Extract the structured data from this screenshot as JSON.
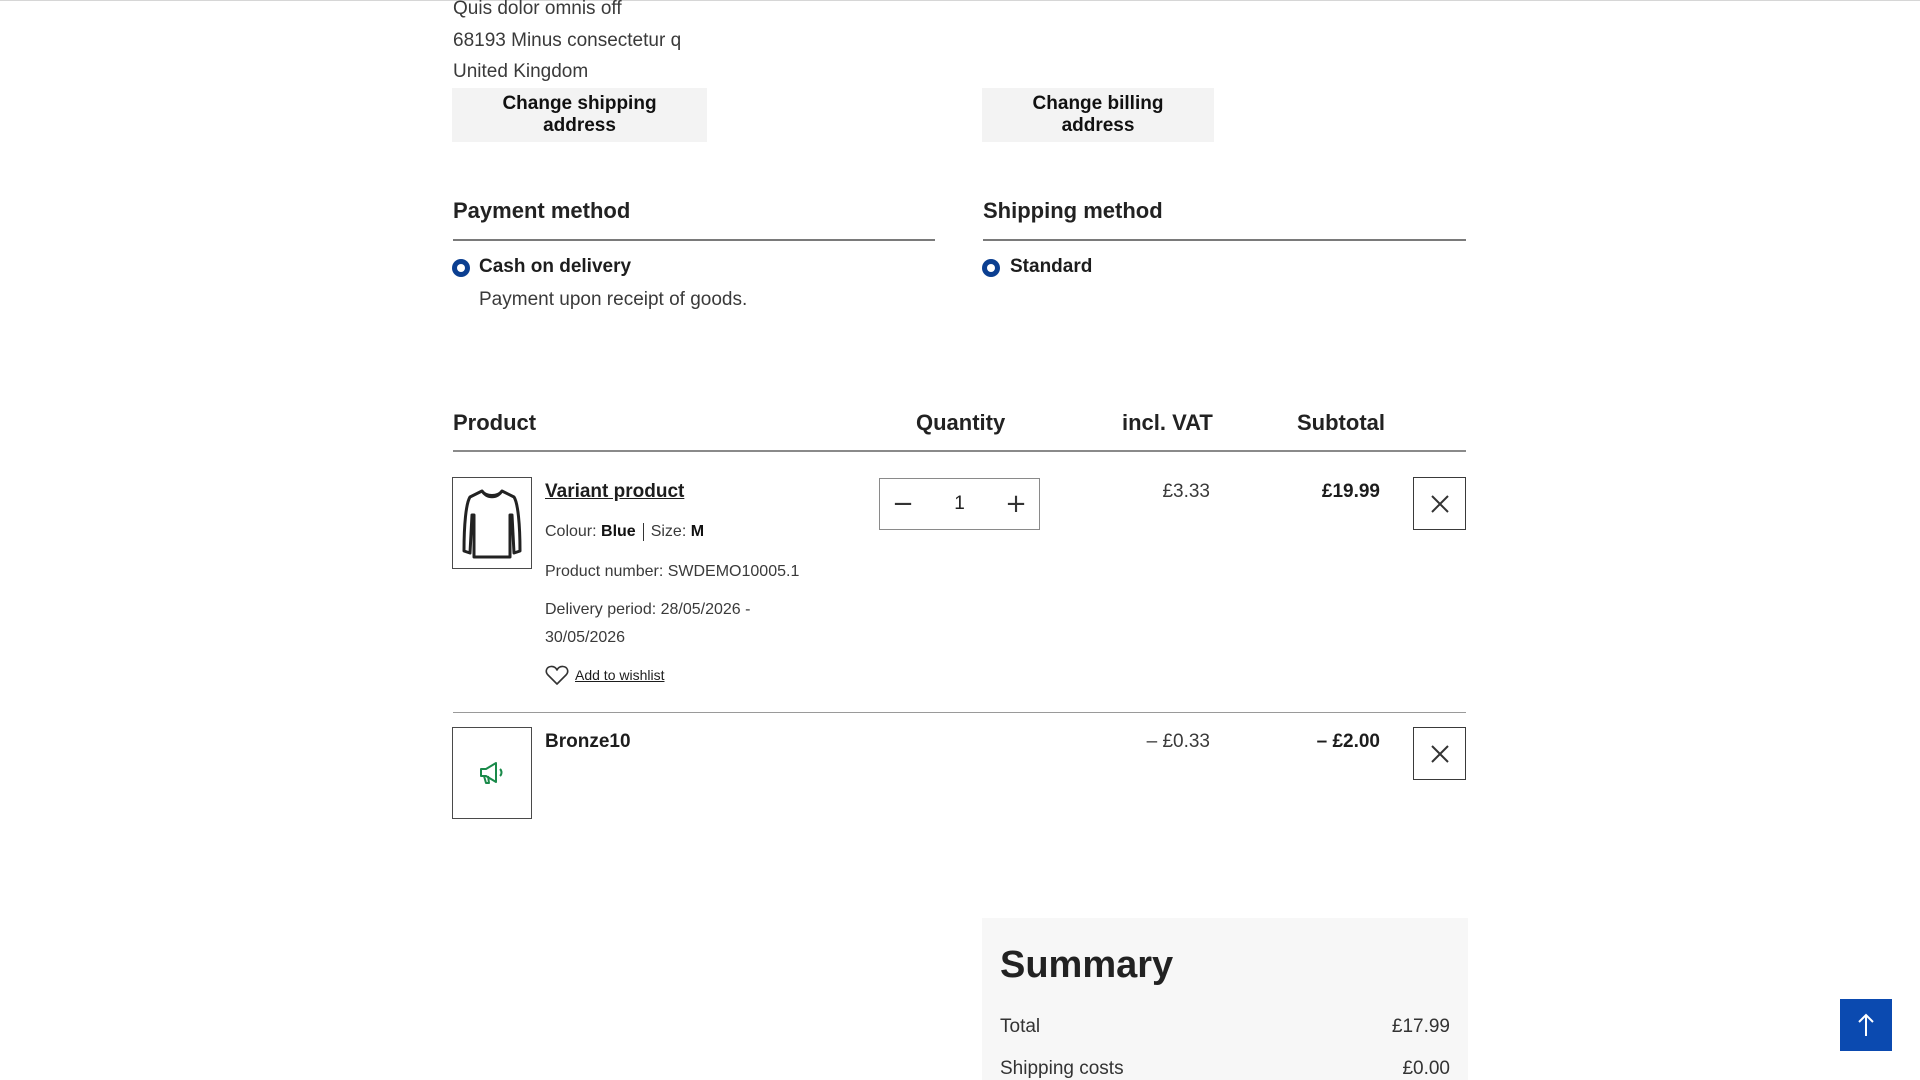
{
  "address": {
    "lines": [
      "Quis dolor omnis off",
      "68193 Minus consectetur q",
      "United Kingdom"
    ],
    "change_shipping_label": "Change shipping address",
    "change_billing_label": "Change billing address"
  },
  "payment": {
    "title": "Payment method",
    "option_label": "Cash on delivery",
    "option_desc": "Payment upon receipt of goods."
  },
  "shipping": {
    "title": "Shipping method",
    "option_label": "Standard"
  },
  "table": {
    "headers": {
      "product": "Product",
      "quantity": "Quantity",
      "vat": "incl. VAT",
      "subtotal": "Subtotal"
    },
    "items": [
      {
        "name": "Variant product",
        "colour_label": "Colour:",
        "colour_value": "Blue",
        "size_label": "Size:",
        "size_value": "M",
        "product_number": "Product number: SWDEMO10005.1",
        "delivery_line1": "Delivery period: 28/05/2026 -",
        "delivery_line2": "30/05/2026",
        "wishlist_label": "Add to wishlist",
        "quantity": "1",
        "vat": "£3.33",
        "subtotal": "£19.99",
        "thumb_icon": "longsleeve-shirt-icon"
      },
      {
        "name": "Bronze10",
        "vat": "– £0.33",
        "subtotal": "– £2.00",
        "thumb_icon": "megaphone-icon"
      }
    ]
  },
  "summary": {
    "title": "Summary",
    "rows": [
      {
        "label": "Total",
        "value": "£17.99"
      },
      {
        "label": "Shipping costs",
        "value": "£0.00"
      }
    ]
  },
  "colors": {
    "accent": "#0b3f91",
    "scroll_top_bg": "#0b4ab0",
    "promo_icon": "#1a8a4a"
  },
  "icons": {
    "minus": "−",
    "plus": "+",
    "remove": "close-icon",
    "scroll_top": "arrow-up-icon"
  }
}
